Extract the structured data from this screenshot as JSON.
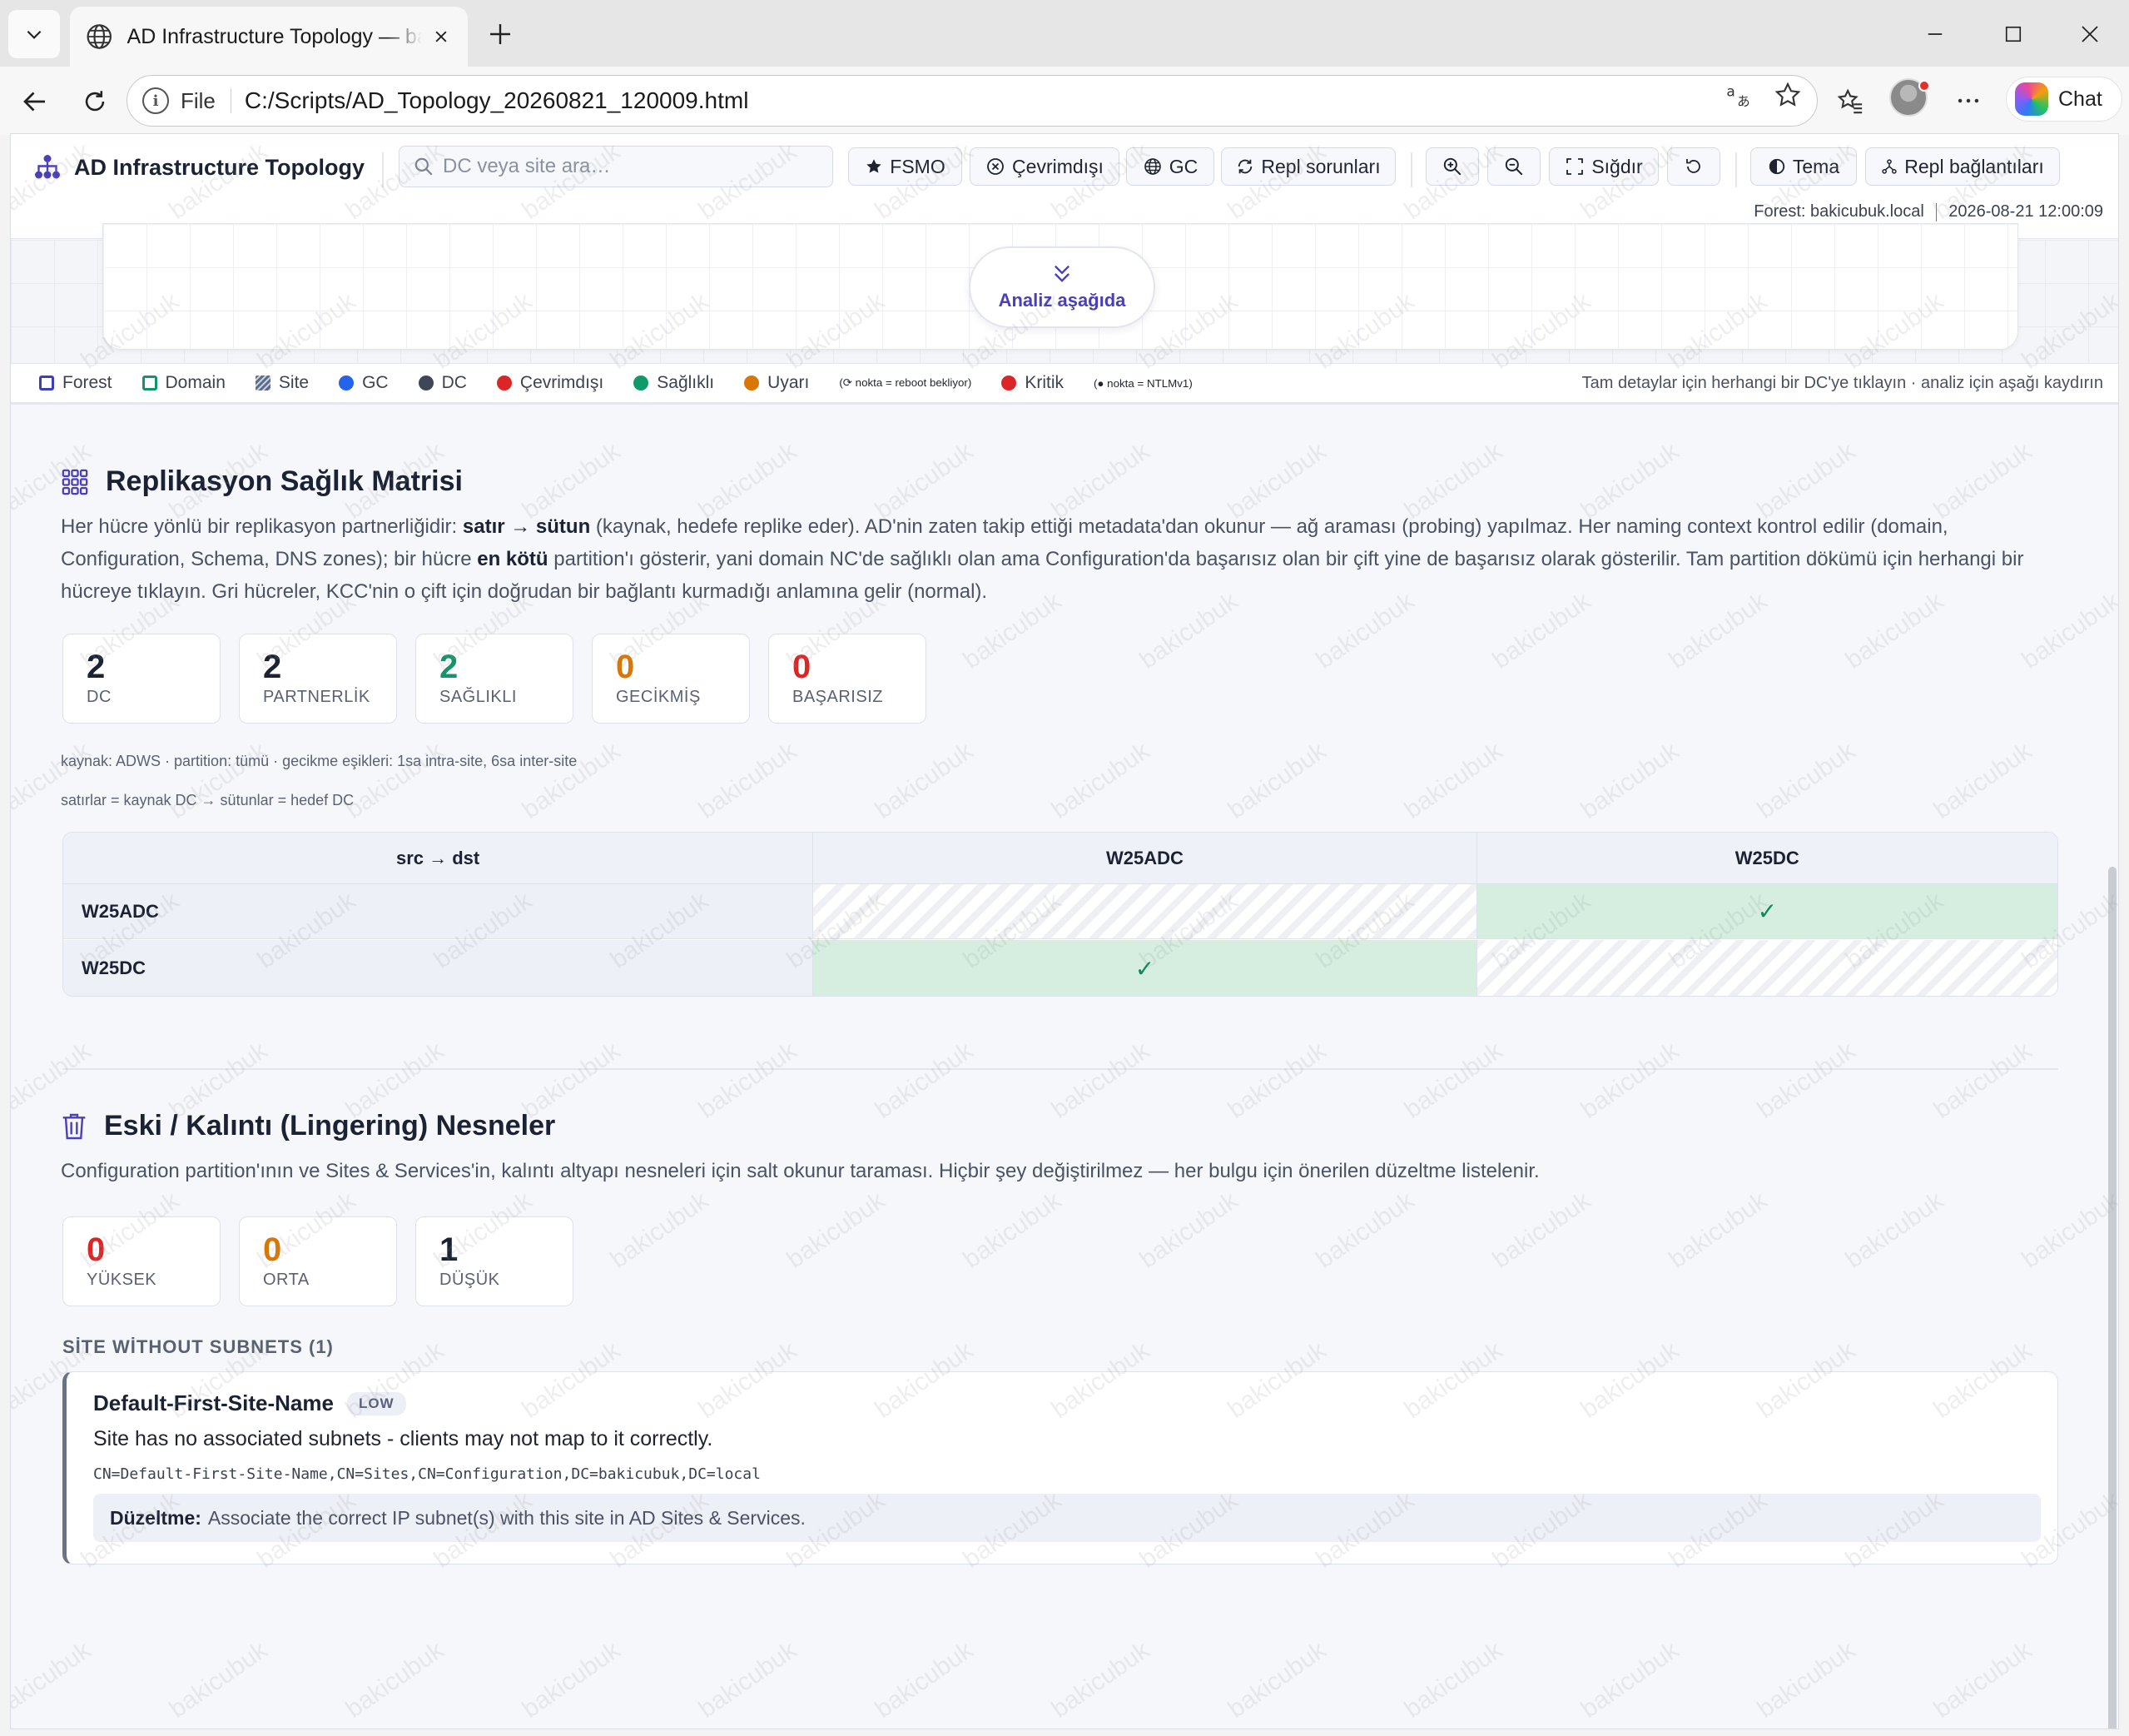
{
  "browser": {
    "tab_title": "AD Infrastructure Topology — bakicubuk.local",
    "scheme": "File",
    "url": "C:/Scripts/AD_Topology_20260821_120009.html",
    "chat_label": "Chat"
  },
  "app": {
    "title": "AD Infrastructure Topology",
    "search_placeholder": "DC veya site ara…",
    "buttons": {
      "fsmo": "FSMO",
      "offline": "Çevrimdışı",
      "gc": "GC",
      "repl_issues": "Repl sorunları",
      "fit": "Sığdır",
      "theme": "Tema",
      "repl_links": "Repl bağlantıları"
    },
    "forest": "Forest: bakicubuk.local",
    "timestamp": "2026-08-21 12:00:09",
    "analysis_button": "Analiz aşağıda"
  },
  "legend": {
    "items": [
      {
        "label": "Forest",
        "color": "#3b3fb8",
        "shape": "square"
      },
      {
        "label": "Domain",
        "color": "#16936b",
        "shape": "square"
      },
      {
        "label": "Site",
        "color": "#5a6a88",
        "shape": "hatched"
      },
      {
        "label": "GC",
        "color": "#2563eb",
        "shape": "dot"
      },
      {
        "label": "DC",
        "color": "#3f4756",
        "shape": "dot"
      },
      {
        "label": "Çevrimdışı",
        "color": "#dc2626",
        "shape": "dot"
      },
      {
        "label": "Sağlıklı",
        "color": "#0f9a6a",
        "shape": "dot"
      },
      {
        "label": "Uyarı",
        "color": "#d97706",
        "shape": "dot"
      },
      {
        "label": "Kritik",
        "color": "#dc2626",
        "shape": "dot"
      }
    ],
    "note_reboot": "(⟳ nokta = reboot bekliyor)",
    "note_ntlm": "(● nokta = NTLMv1)",
    "hint": "Tam detaylar için herhangi bir DC'ye tıklayın · analiz için aşağı kaydırın"
  },
  "replication": {
    "title": "Replikasyon Sağlık Matrisi",
    "desc_1": "Her hücre yönlü bir replikasyon partnerliğidir: ",
    "desc_b1": "satır → sütun",
    "desc_2": " (kaynak, hedefe replike eder). AD'nin zaten takip ettiği metadata'dan okunur — ağ araması (probing) yapılmaz. Her naming context kontrol edilir (domain, Configuration, Schema, DNS zones); bir hücre ",
    "desc_b2": "en kötü",
    "desc_3": " partition'ı gösterir, yani domain NC'de sağlıklı olan ama Configuration'da başarısız olan bir çift yine de başarısız olarak gösterilir. Tam partition dökümü için herhangi bir hücreye tıklayın. Gri hücreler, KCC'nin o çift için doğrudan bir bağlantı kurmadığı anlamına gelir (normal).",
    "stats": [
      {
        "value": "2",
        "label": "DC",
        "color": "#1a2233"
      },
      {
        "value": "2",
        "label": "PARTNERLİK",
        "color": "#1a2233"
      },
      {
        "value": "2",
        "label": "SAĞLIKLI",
        "color": "#16936b"
      },
      {
        "value": "0",
        "label": "GECİKMİŞ",
        "color": "#d97706"
      },
      {
        "value": "0",
        "label": "BAŞARISIZ",
        "color": "#dc2626"
      }
    ],
    "source_note": "kaynak: ADWS · partition: tümü · gecikme eşikleri: 1sa intra-site, 6sa inter-site",
    "axis_note": "satırlar = kaynak DC  →  sütunlar = hedef DC",
    "matrix": {
      "corner": "src → dst",
      "columns": [
        "W25ADC",
        "W25DC"
      ],
      "rows": [
        {
          "name": "W25ADC",
          "cells": [
            "self",
            "ok"
          ]
        },
        {
          "name": "W25DC",
          "cells": [
            "ok",
            "self"
          ]
        }
      ],
      "ok_mark": "✓"
    }
  },
  "lingering": {
    "title": "Eski / Kalıntı (Lingering) Nesneler",
    "desc": "Configuration partition'ının ve Sites & Services'in, kalıntı altyapı nesneleri için salt okunur taraması. Hiçbir şey değiştirilmez — her bulgu için önerilen düzeltme listelenir.",
    "stats": [
      {
        "value": "0",
        "label": "YÜKSEK",
        "color": "#dc2626"
      },
      {
        "value": "0",
        "label": "ORTA",
        "color": "#d97706"
      },
      {
        "value": "1",
        "label": "DÜŞÜK",
        "color": "#1a2233"
      }
    ],
    "group_title": "SİTE WİTHOUT SUBNETS (1)",
    "finding": {
      "name": "Default-First-Site-Name",
      "severity": "LOW",
      "description": "Site has no associated subnets - clients may not map to it correctly.",
      "dn": "CN=Default-First-Site-Name,CN=Sites,CN=Configuration,DC=bakicubuk,DC=local",
      "fix_label": "Düzeltme:",
      "fix_text": "Associate the correct IP subnet(s) with this site in AD Sites & Services."
    }
  },
  "watermark": "bakicubuk"
}
